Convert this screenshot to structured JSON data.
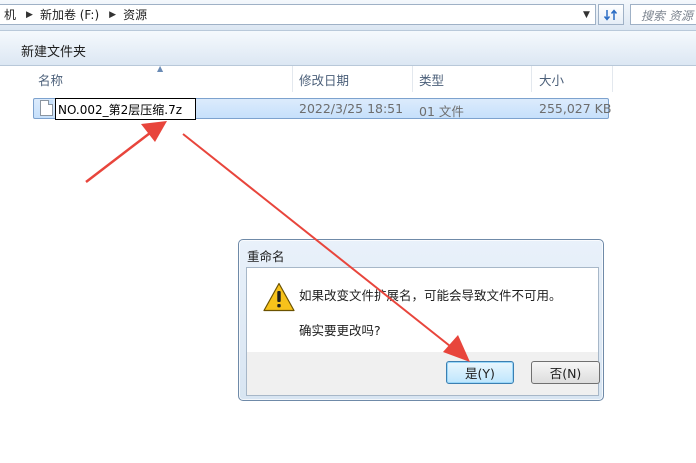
{
  "address_bar": {
    "breadcrumbs": [
      "机",
      "新加卷 (F:)",
      "资源"
    ],
    "search_placeholder": "搜索 资源"
  },
  "toolbar": {
    "new_folder_label": "新建文件夹"
  },
  "columns": {
    "name": "名称",
    "modified": "修改日期",
    "type": "类型",
    "size": "大小"
  },
  "file": {
    "name": "NO.002_第2层压缩.7z",
    "modified": "2022/3/25 18:51",
    "type": "01 文件",
    "size": "255,027 KB"
  },
  "dialog": {
    "title": "重命名",
    "message_line1": "如果改变文件扩展名，可能会导致文件不可用。",
    "message_line2": "确实要更改吗?",
    "yes_label": "是(Y)",
    "no_label": "否(N)"
  },
  "colors": {
    "annotation_arrow": "#e8453c",
    "selection_fill": "#c6e0fb",
    "warning_yellow": "#f7c21b"
  },
  "icons": [
    "chevron-right-icon",
    "chevron-down-icon",
    "refresh-icon",
    "file-icon",
    "warning-icon",
    "sort-up-icon"
  ]
}
